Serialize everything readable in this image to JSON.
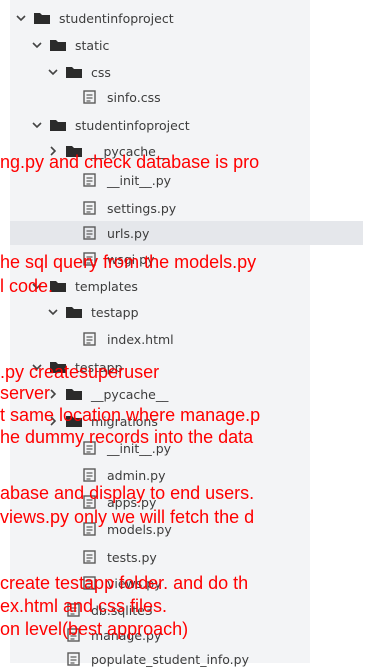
{
  "tree": {
    "rows": [
      {
        "label": "studentinfoproject",
        "type": "folder",
        "expanded": true
      },
      {
        "label": "static",
        "type": "folder",
        "expanded": true
      },
      {
        "label": "css",
        "type": "folder",
        "expanded": true
      },
      {
        "label": "sinfo.css",
        "type": "file"
      },
      {
        "label": "studentinfoproject",
        "type": "folder",
        "expanded": true
      },
      {
        "label": "__pycache__",
        "type": "folder",
        "expanded": false
      },
      {
        "label": "__init__.py",
        "type": "file"
      },
      {
        "label": "settings.py",
        "type": "file"
      },
      {
        "label": "urls.py",
        "type": "file",
        "selected": true
      },
      {
        "label": "wsgi.py",
        "type": "file"
      },
      {
        "label": "templates",
        "type": "folder",
        "expanded": true
      },
      {
        "label": "testapp",
        "type": "folder",
        "expanded": true
      },
      {
        "label": "index.html",
        "type": "file"
      },
      {
        "label": "testapp",
        "type": "folder",
        "expanded": true
      },
      {
        "label": "__pycache__",
        "type": "folder",
        "expanded": false
      },
      {
        "label": "migrations",
        "type": "folder",
        "expanded": false
      },
      {
        "label": "__init__.py",
        "type": "file"
      },
      {
        "label": "admin.py",
        "type": "file"
      },
      {
        "label": "apps.py",
        "type": "file"
      },
      {
        "label": "models.py",
        "type": "file"
      },
      {
        "label": "tests.py",
        "type": "file"
      },
      {
        "label": "views.py",
        "type": "file"
      },
      {
        "label": "db.sqlite3",
        "type": "file"
      },
      {
        "label": "manage.py",
        "type": "file"
      },
      {
        "label": "populate_student_info.py",
        "type": "file"
      }
    ]
  },
  "overlay": {
    "lines": [
      "ng.py and check database is pro",
      "he sql query from the models.py",
      "l code.",
      ".py createsuperuser",
      "server",
      "t same location where manage.p",
      "he dummy records into the data",
      "abase and display to end users.",
      "views.py only we will fetch the d",
      "create testapp folder. and do th",
      "ex.html and css files.",
      "on level(best approach)"
    ]
  },
  "colors": {
    "panel_bg": "#f3f4f6",
    "selected_bg": "#e5e7eb",
    "tree_text": "#3c3c3c",
    "folder": "#2b2b2b",
    "file": "#5a5a5a",
    "overlay_text": "#ff0000"
  }
}
